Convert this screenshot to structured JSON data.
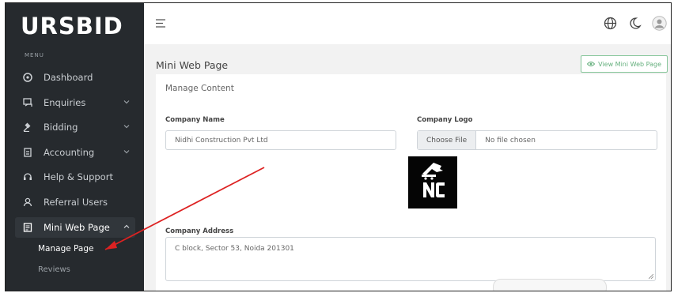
{
  "sidebar": {
    "brand": "URSBID",
    "menu_label": "MENU",
    "items": [
      {
        "label": "Dashboard",
        "icon": "dashboard-icon"
      },
      {
        "label": "Enquiries",
        "icon": "enquiries-icon"
      },
      {
        "label": "Bidding",
        "icon": "gavel-icon"
      },
      {
        "label": "Accounting",
        "icon": "accounting-icon"
      },
      {
        "label": "Help & Support",
        "icon": "headset-icon"
      },
      {
        "label": "Referral Users",
        "icon": "users-icon"
      },
      {
        "label": "Mini Web Page",
        "icon": "webpage-icon"
      }
    ],
    "subitems": [
      {
        "label": "Manage Page"
      },
      {
        "label": "Reviews"
      }
    ]
  },
  "topbar": {
    "icons": [
      "menu-icon",
      "globe-icon",
      "moon-icon",
      "avatar-icon"
    ]
  },
  "page": {
    "title": "Mini Web Page",
    "view_button_label": "View Mini Web Page",
    "section_title": "Manage Content"
  },
  "form": {
    "company_name_label": "Company Name",
    "company_name_value": "Nidhi Construction Pvt Ltd",
    "company_logo_label": "Company Logo",
    "file_button_label": "Choose File",
    "file_status": "No file chosen",
    "logo_letters": "NC",
    "company_address_label": "Company Address",
    "company_address_value": "C block, Sector 53, Noida 201301"
  },
  "colors": {
    "sidebar_bg": "#262a2e",
    "accent_green": "#66b07e",
    "annotation_red": "#dd2222"
  }
}
